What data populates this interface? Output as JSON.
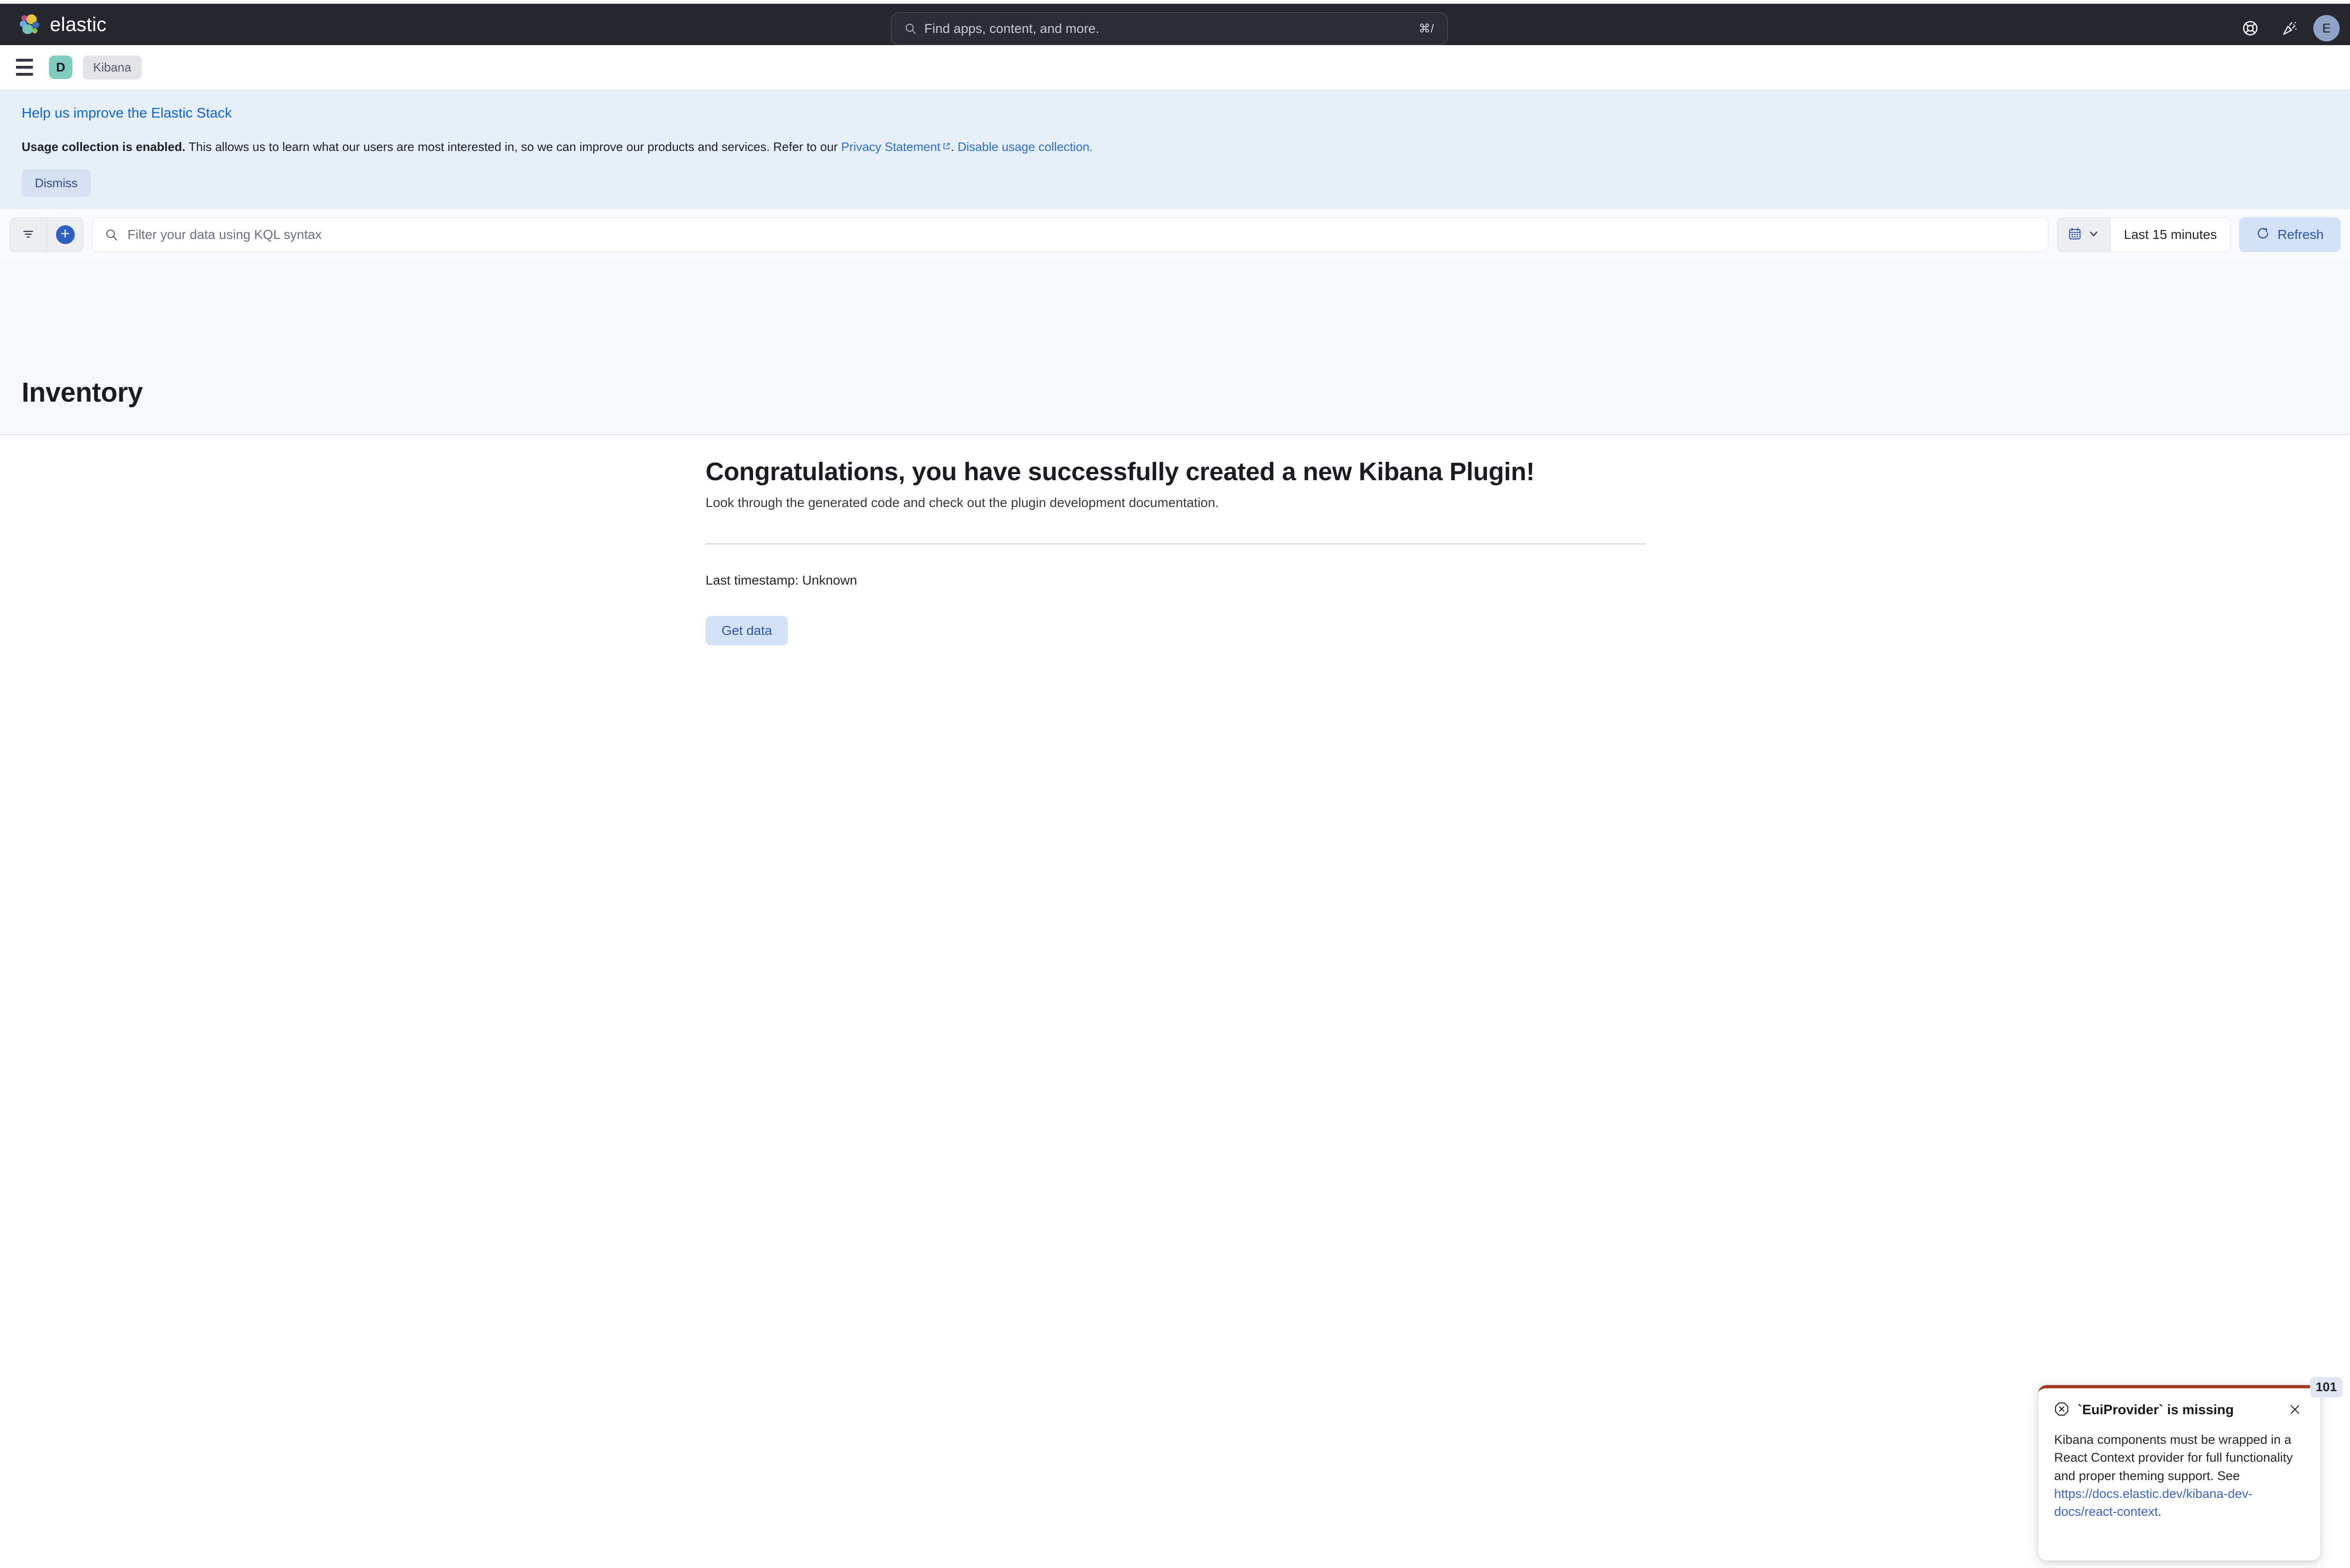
{
  "header": {
    "brand_name": "elastic",
    "logo_name": "elastic-logo",
    "search": {
      "placeholder": "Find apps, content, and more.",
      "shortcut": "⌘/"
    },
    "help_icon": "life-preserver-icon",
    "news_icon": "confetti-icon",
    "avatar_initial": "E"
  },
  "breadcrumbs": {
    "menu_icon": "hamburger-menu-icon",
    "space_initial": "D",
    "crumb_label": "Kibana"
  },
  "telemetry_banner": {
    "title": "Help us improve the Elastic Stack",
    "body_bold": "Usage collection is enabled.",
    "body_text": " This allows us to learn what our users are most interested in, so we can improve our products and services. Refer to our ",
    "privacy_link": "Privacy Statement",
    "body_mid": ". ",
    "disable_link": "Disable usage collection.",
    "dismiss_label": "Dismiss"
  },
  "query_bar": {
    "filter_icon": "filter-icon",
    "add_filter_icon": "add-filter-plus-icon",
    "kql_placeholder": "Filter your data using KQL syntax",
    "calendar_icon": "calendar-icon",
    "chevron_icon": "chevron-down-icon",
    "date_range": "Last 15 minutes",
    "refresh_icon": "refresh-icon",
    "refresh_label": "Refresh"
  },
  "page": {
    "title": "Inventory"
  },
  "main": {
    "heading": "Congratulations, you have successfully created a new Kibana Plugin!",
    "subheading": "Look through the generated code and check out the plugin development documentation.",
    "timestamp_label": "Last timestamp: Unknown",
    "get_data_label": "Get data"
  },
  "toast": {
    "error_icon": "error-octagon-icon",
    "title": "`EuiProvider` is missing",
    "close_icon": "close-icon",
    "body_text": "Kibana components must be wrapped in a React Context provider for full functionality and proper theming support. See ",
    "link_text": "https://docs.elastic.dev/kibana-dev-docs/react-context",
    "body_tail": ".",
    "badge_count": "101"
  },
  "colors": {
    "header_bg": "#25262E",
    "accent_blue": "#2F5EC4",
    "link_blue": "#2D6CD8",
    "banner_bg": "#E7EFF8",
    "space_avatar": "#7FCBBD",
    "user_avatar": "#8FA3C7",
    "toast_error_border": "#A13B23"
  }
}
